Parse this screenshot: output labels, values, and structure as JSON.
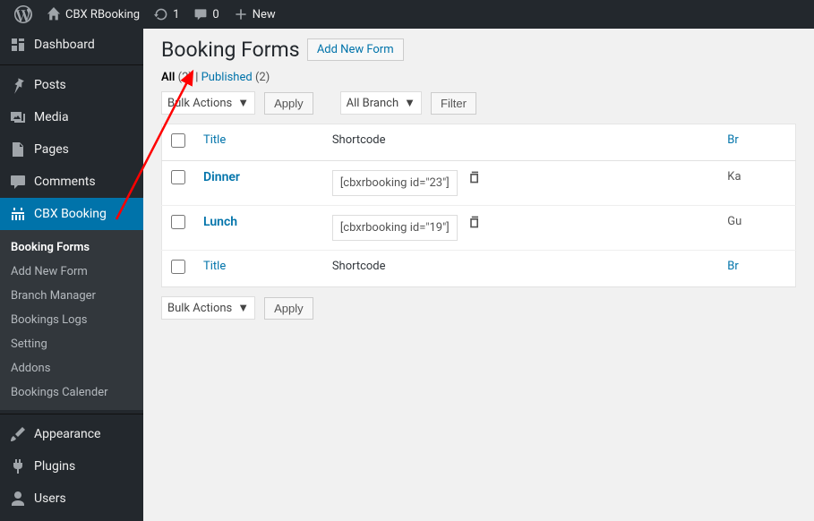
{
  "toolbar": {
    "site_name": "CBX RBooking",
    "updates_count": "1",
    "comments_count": "0",
    "new_label": "New"
  },
  "sidebar": {
    "items": [
      {
        "label": "Dashboard"
      },
      {
        "label": "Posts"
      },
      {
        "label": "Media"
      },
      {
        "label": "Pages"
      },
      {
        "label": "Comments"
      },
      {
        "label": "CBX Booking"
      },
      {
        "label": "Appearance"
      },
      {
        "label": "Plugins"
      },
      {
        "label": "Users"
      }
    ],
    "submenu": [
      "Booking Forms",
      "Add New Form",
      "Branch Manager",
      "Bookings Logs",
      "Setting",
      "Addons",
      "Bookings Calender"
    ]
  },
  "page": {
    "title": "Booking Forms",
    "add_new": "Add New Form",
    "filters": {
      "all_label": "All",
      "all_count": "(2)",
      "published_label": "Published",
      "published_count": "(2)",
      "separator": " | "
    },
    "bulk_label": "Bulk Actions",
    "apply_label": "Apply",
    "branch_label": "All Branch",
    "filter_label": "Filter",
    "columns": {
      "title": "Title",
      "shortcode": "Shortcode",
      "branch": "Br"
    },
    "rows": [
      {
        "title": "Dinner",
        "shortcode": "[cbxrbooking id=\"23\"]",
        "branch": "Ka"
      },
      {
        "title": "Lunch",
        "shortcode": "[cbxrbooking id=\"19\"]",
        "branch": "Gu"
      }
    ]
  }
}
